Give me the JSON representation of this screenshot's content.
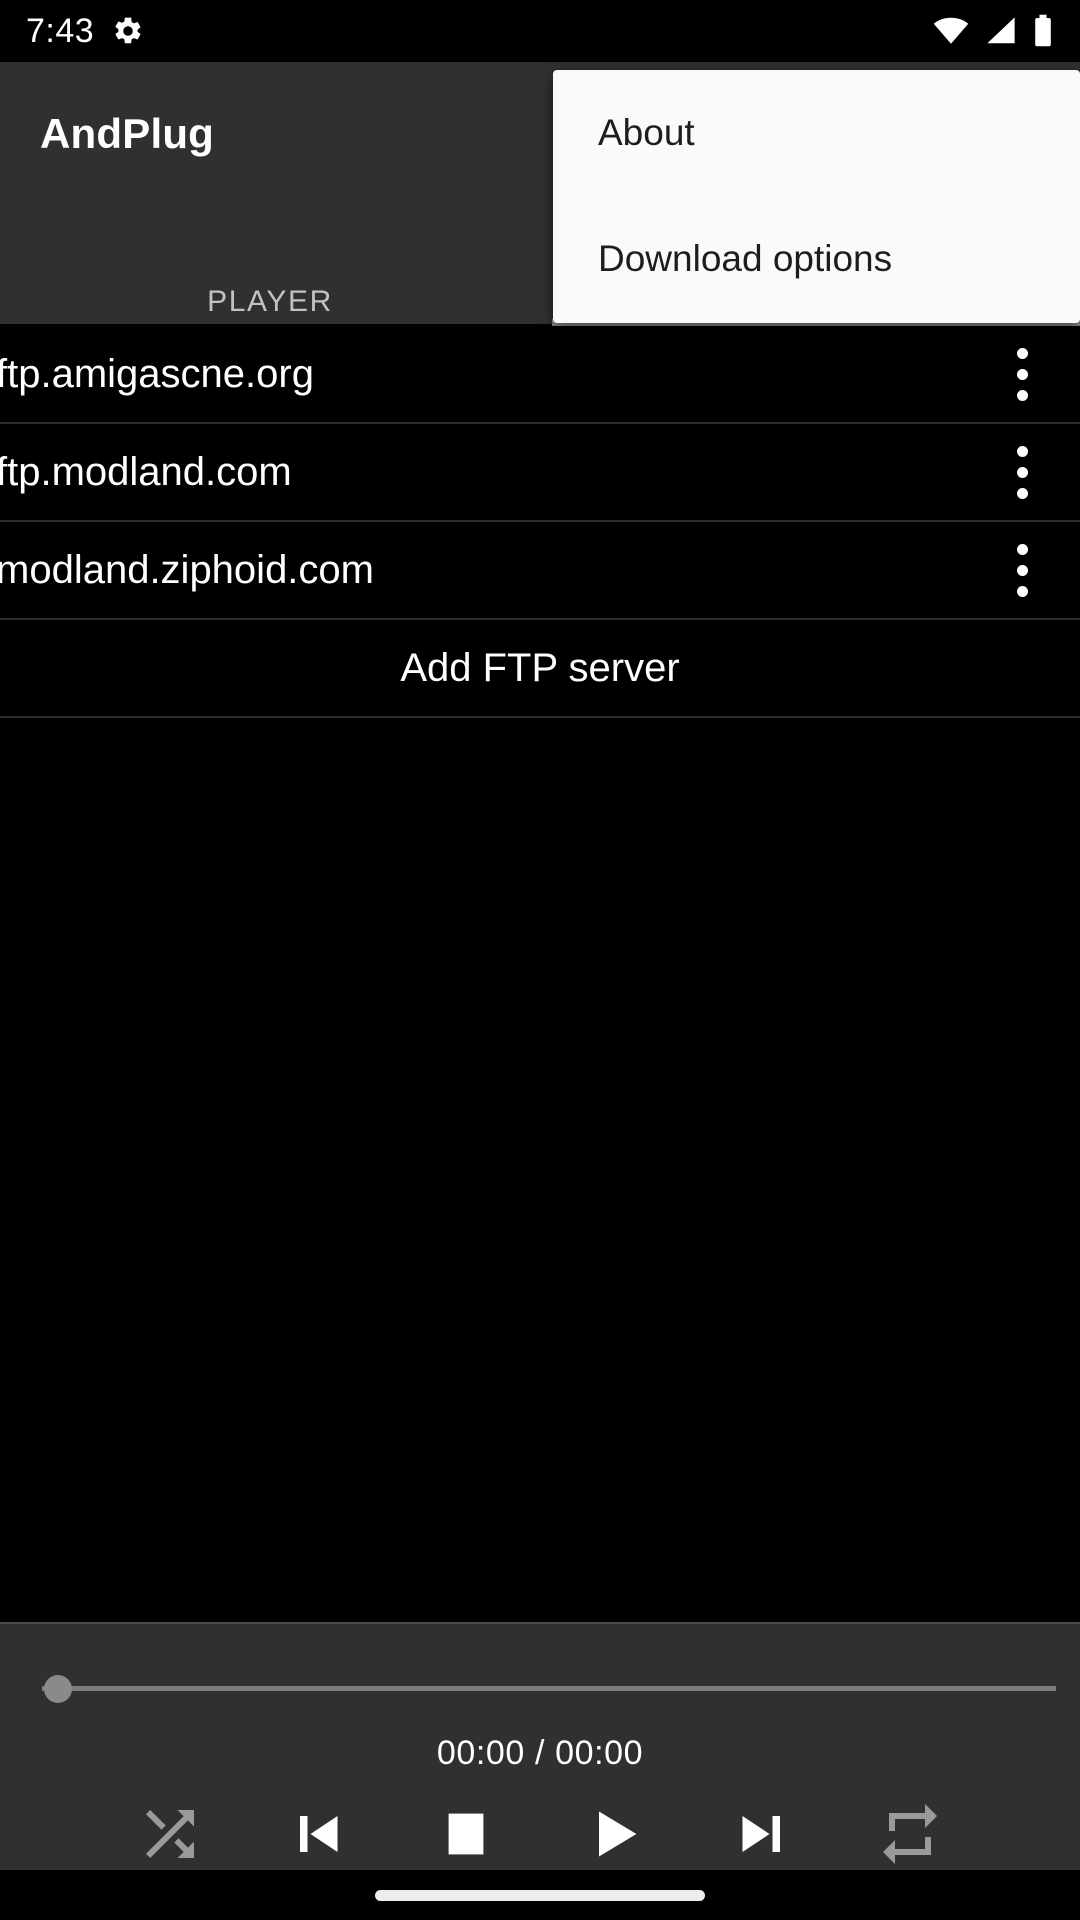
{
  "statusbar": {
    "time": "7:43",
    "icons": [
      "settings-gear-icon",
      "wifi-icon",
      "cell-signal-icon",
      "battery-icon"
    ]
  },
  "toolbar": {
    "app_title": "AndPlug",
    "tabs": [
      {
        "label": "PLAYER",
        "selected": true
      }
    ],
    "background": "#303030"
  },
  "overflow_menu": {
    "visible": true,
    "background": "#FAFAFA",
    "items": [
      {
        "label": "About"
      },
      {
        "label": "Download options"
      }
    ]
  },
  "server_list": {
    "rows": [
      {
        "host": "ftp.amigascne.org",
        "overflow_icon": "more-vert-icon"
      },
      {
        "host": "ftp.modland.com",
        "overflow_icon": "more-vert-icon"
      },
      {
        "host": "modland.ziphoid.com",
        "overflow_icon": "more-vert-icon"
      }
    ],
    "add_label": "Add FTP server"
  },
  "player": {
    "seek": {
      "position_percent": 0,
      "thumb_color": "#8A8A8A",
      "track_color": "#7D7D7D"
    },
    "time_display": "00:00 / 00:00",
    "elapsed": "00:00",
    "duration": "00:00",
    "controls": [
      {
        "name": "shuffle-icon",
        "label": "Shuffle",
        "color": "#9A9A9A",
        "enabled": false
      },
      {
        "name": "previous-icon",
        "label": "Previous",
        "color": "#FFFFFF",
        "enabled": true
      },
      {
        "name": "stop-icon",
        "label": "Stop",
        "color": "#FFFFFF",
        "enabled": true
      },
      {
        "name": "play-icon",
        "label": "Play",
        "color": "#FFFFFF",
        "enabled": true
      },
      {
        "name": "next-icon",
        "label": "Next",
        "color": "#FFFFFF",
        "enabled": true
      },
      {
        "name": "repeat-icon",
        "label": "Repeat",
        "color": "#9A9A9A",
        "enabled": false
      }
    ]
  },
  "navigation": {
    "gesture_pill": true
  }
}
